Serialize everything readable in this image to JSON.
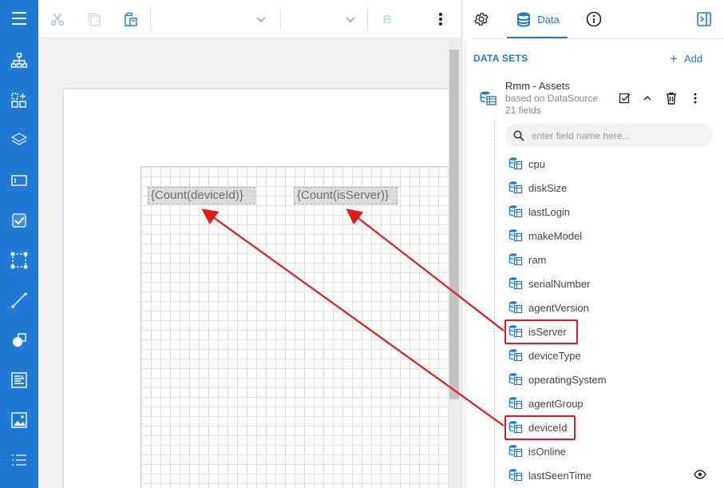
{
  "toolbar": {
    "icons": [
      "cut-icon",
      "copy-icon",
      "paste-icon",
      "chevron-down-icon",
      "chevron-down-icon",
      "more-vertical-icon"
    ],
    "bold_label": "B"
  },
  "sidebar": {
    "items": [
      "menu-icon",
      "report-tree-icon",
      "add-component-icon",
      "layers-icon",
      "text-box-icon",
      "checkbox-icon",
      "selection-icon",
      "line-icon",
      "shapes-icon",
      "rich-text-icon",
      "image-icon",
      "list-icon"
    ]
  },
  "panel": {
    "tabs": {
      "data_label": "Data"
    },
    "datasets_header": "DATA SETS",
    "add_label": "Add",
    "dataset": {
      "name": "Rmm - Assets",
      "source": "based on DataSource",
      "fields_count": "21 fields"
    },
    "search_placeholder": "enter field name here...",
    "fields": [
      "cpu",
      "diskSize",
      "lastLogin",
      "makeModel",
      "ram",
      "serialNumber",
      "agentVersion",
      "isServer",
      "deviceType",
      "operatingSystem",
      "agentGroup",
      "deviceId",
      "isOnline",
      "lastSeenTime"
    ]
  },
  "canvas": {
    "expr1": "{Count(deviceId)}",
    "expr2": "{Count(isServer)}"
  },
  "colors": {
    "accent": "#1f7ad6",
    "highlight": "#e01b1b"
  }
}
